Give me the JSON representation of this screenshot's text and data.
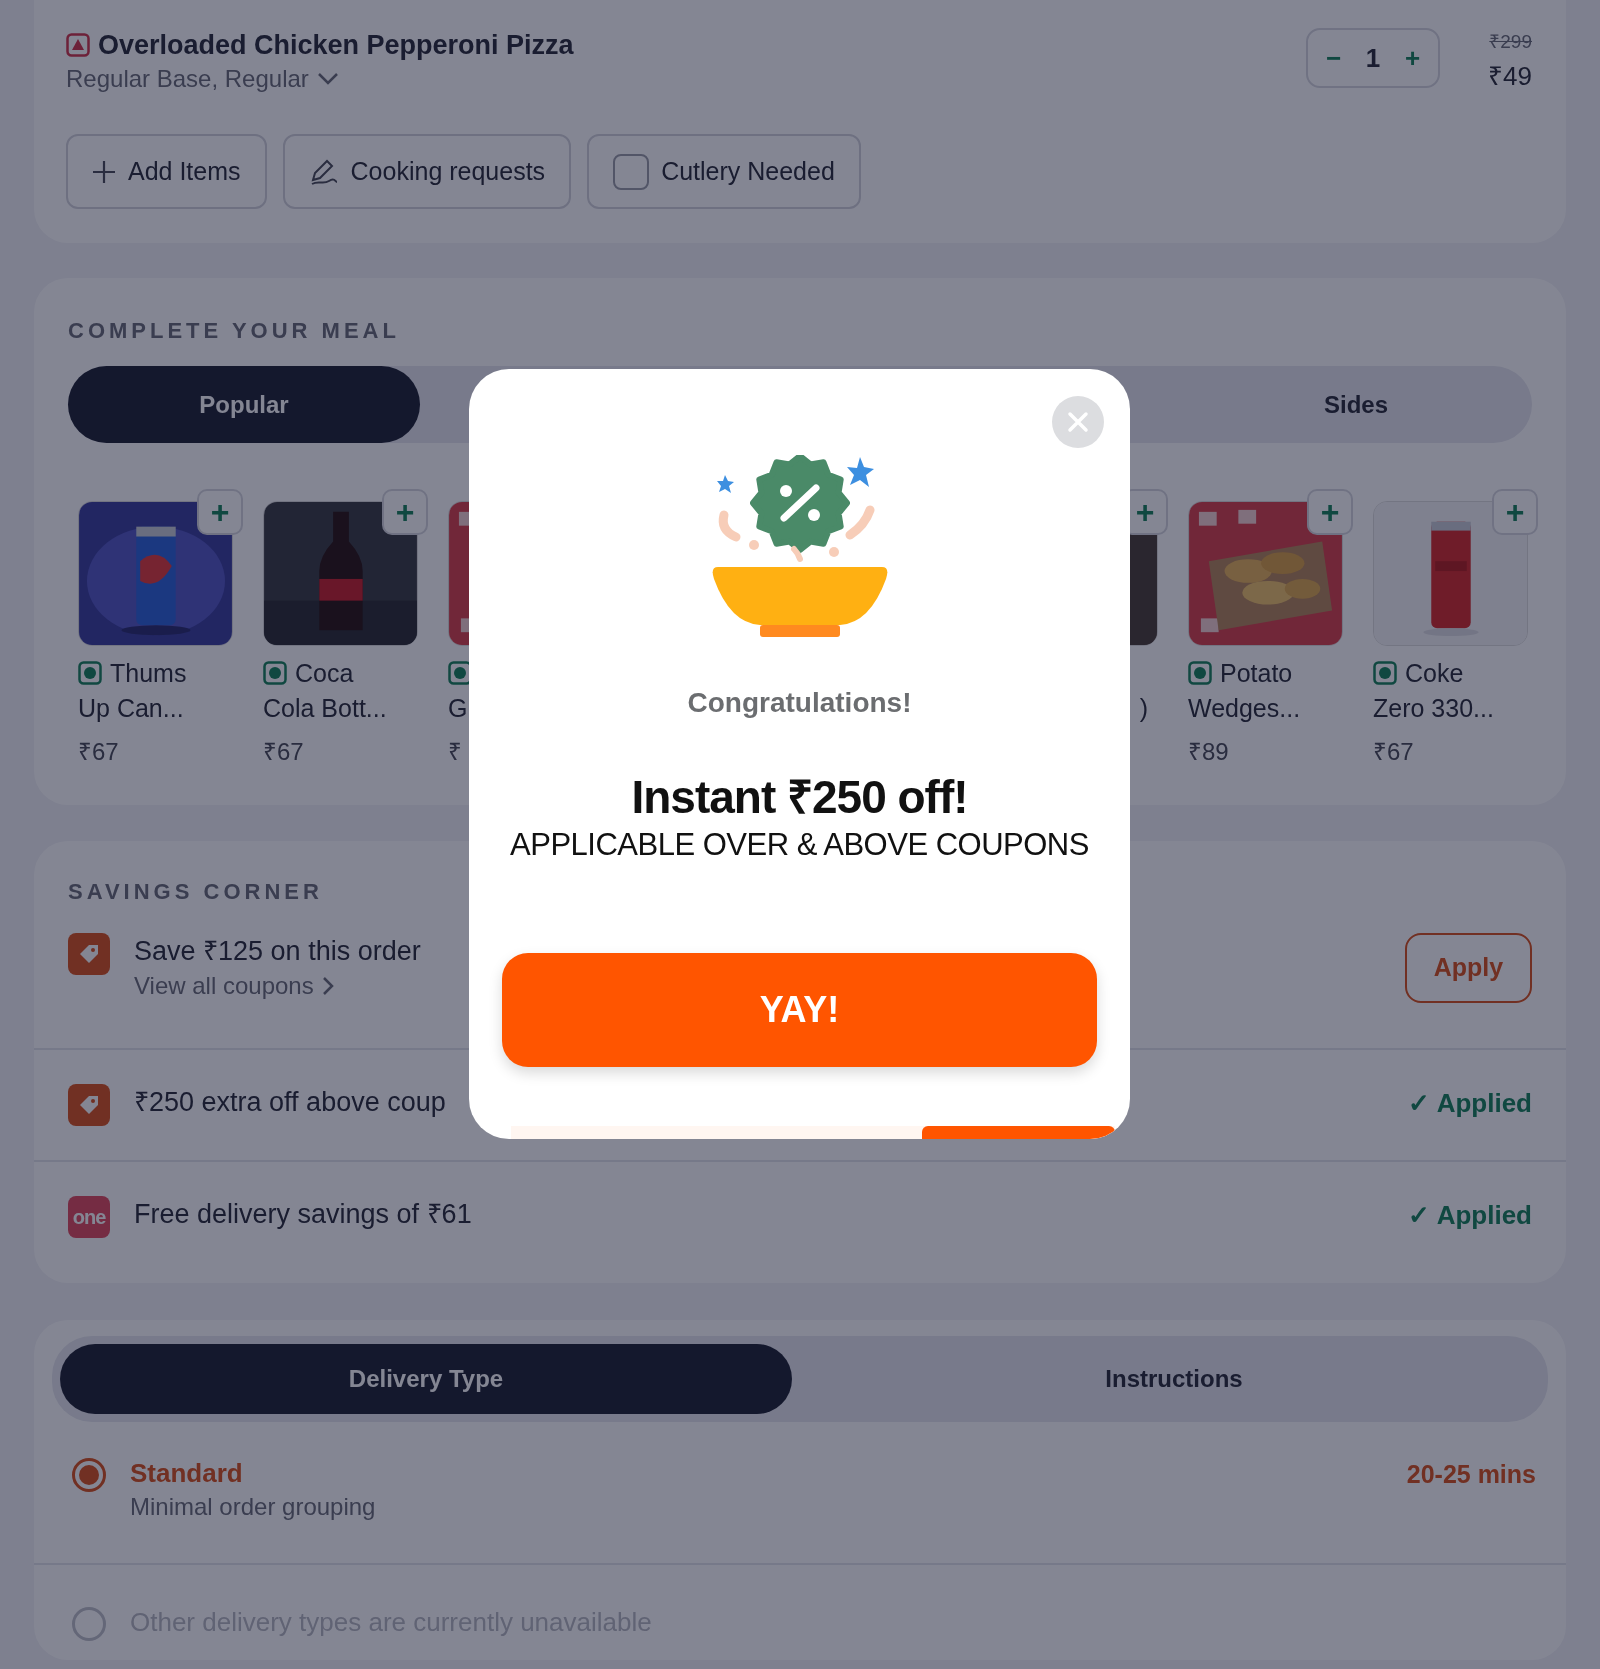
{
  "cart_item": {
    "name": "Overloaded Chicken Pepperoni Pizza",
    "veg": false,
    "options": "Regular Base, Regular",
    "decrement": "−",
    "quantity": "1",
    "increment": "+",
    "original_price": "₹299",
    "price": "₹49"
  },
  "item_actions": [
    {
      "kind": "add",
      "label": "Add Items"
    },
    {
      "kind": "note",
      "label": "Cooking requests"
    },
    {
      "kind": "checkbox",
      "label": "Cutlery Needed",
      "checked": false
    }
  ],
  "complete_meal": {
    "heading": "COMPLETE YOUR MEAL",
    "tabs": [
      {
        "label": "Popular",
        "selected": true
      },
      {
        "label": "Sides",
        "selected": false
      }
    ],
    "items": [
      {
        "kind": "full",
        "veg": true,
        "add": "+",
        "name": "Thums Up Can...",
        "price": "₹67"
      },
      {
        "kind": "full",
        "veg": true,
        "add": "+",
        "name": "Coca Cola Bott...",
        "price": "₹67"
      },
      {
        "kind": "cut-right",
        "veg": true,
        "name": "G",
        "price": "₹"
      },
      {
        "kind": "cut-left",
        "add": "+",
        "name": ")"
      },
      {
        "kind": "full",
        "veg": true,
        "add": "+",
        "name": "Potato Wedges...",
        "price": "₹89"
      },
      {
        "kind": "full",
        "veg": true,
        "add": "+",
        "name": "Coke Zero 330...",
        "price": "₹67"
      }
    ]
  },
  "savings_corner": {
    "heading": "SAVINGS CORNER",
    "offers": [
      {
        "kind": "tag",
        "title": "Save ₹125 on this order",
        "link": "View all coupons",
        "action": "Apply"
      },
      {
        "kind": "tag",
        "title": "₹250 extra off above coup",
        "status": "✓ Applied"
      },
      {
        "kind": "membership",
        "icon_text": "one",
        "title": "Free delivery savings of ₹61",
        "status": "✓ Applied"
      }
    ]
  },
  "delivery": {
    "tabs": [
      {
        "label": "Delivery Type",
        "selected": true
      },
      {
        "label": "Instructions",
        "selected": false
      }
    ],
    "options": [
      {
        "label": "Standard",
        "subtitle": "Minimal order grouping",
        "time": "20-25 mins",
        "selected": true,
        "disabled": false
      },
      {
        "label": "Other delivery types are currently unavailable",
        "selected": false,
        "disabled": true
      }
    ]
  },
  "modal": {
    "congrats": "Congratulations!",
    "title": "Instant ₹250 off!",
    "subtitle": "APPLICABLE OVER & ABOVE COUPONS",
    "button": "YAY!",
    "timer": {
      "level": 0.32
    }
  }
}
